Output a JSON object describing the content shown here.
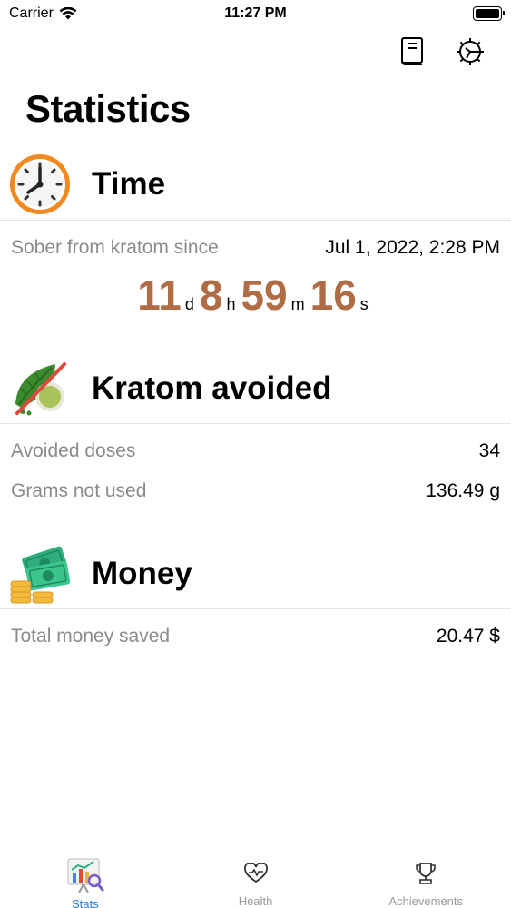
{
  "status_bar": {
    "carrier": "Carrier",
    "time": "11:27 PM"
  },
  "header": {
    "title": "Statistics",
    "icons": [
      "book-icon",
      "gear-icon"
    ]
  },
  "time_section": {
    "title": "Time",
    "icon": "clock-icon",
    "sober_label": "Sober from kratom since",
    "sober_date": "Jul 1, 2022, 2:28 PM",
    "counter": {
      "days": "11",
      "days_unit": "d",
      "hours": "8",
      "hours_unit": "h",
      "minutes": "59",
      "minutes_unit": "m",
      "seconds": "16",
      "seconds_unit": "s"
    }
  },
  "kratom_section": {
    "title": "Kratom avoided",
    "icon": "kratom-leaf-crossed-icon",
    "rows": [
      {
        "label": "Avoided doses",
        "value": "34"
      },
      {
        "label": "Grams not used",
        "value": "136.49 g"
      }
    ]
  },
  "money_section": {
    "title": "Money",
    "icon": "money-icon",
    "rows": [
      {
        "label": "Total money saved",
        "value": "20.47 $"
      }
    ]
  },
  "tab_bar": {
    "tabs": [
      {
        "label": "Stats",
        "icon": "stats-chart-icon",
        "active": true
      },
      {
        "label": "Health",
        "icon": "heart-pulse-icon",
        "active": false
      },
      {
        "label": "Achievements",
        "icon": "trophy-icon",
        "active": false
      }
    ]
  },
  "colors": {
    "counter": "#b06c44",
    "active_tab": "#1a7fe0",
    "label_gray": "#8a8a8f"
  }
}
